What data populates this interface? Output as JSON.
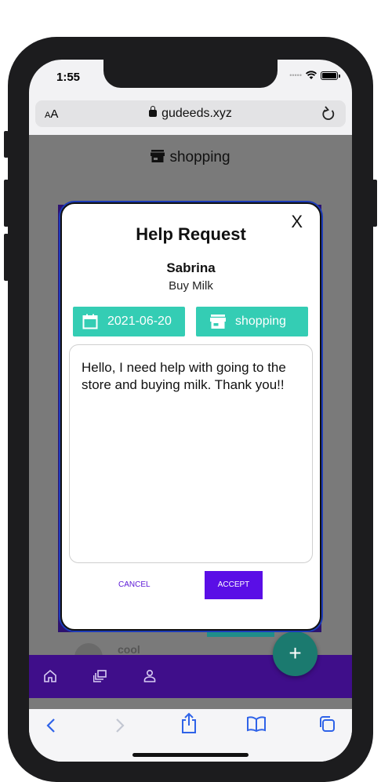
{
  "status": {
    "time": "1:55"
  },
  "browser": {
    "text_size_label": "AA",
    "url": "gudeeds.xyz"
  },
  "page": {
    "heading": "shopping",
    "background_item_name": "cool"
  },
  "modal": {
    "close": "X",
    "title": "Help Request",
    "requester": "Sabrina",
    "request_title": "Buy Milk",
    "date": "2021-06-20",
    "category": "shopping",
    "message": "Hello, I need help with going to the store and buying milk. Thank you!!",
    "cancel_label": "CANCEL",
    "accept_label": "ACCEPT"
  },
  "app_nav": {
    "icons": [
      "home-icon",
      "gallery-icon",
      "profile-icon"
    ],
    "fab_label": "+"
  },
  "toolbar": {
    "icons": [
      "back-icon",
      "forward-icon",
      "share-icon",
      "bookmarks-icon",
      "tabs-icon"
    ]
  },
  "colors": {
    "teal_chip": "#34cdb4",
    "accept": "#5a0ee6",
    "nav_purple": "#3f0e8a",
    "fab": "#1b7a6f",
    "overlay": "#7a7a7a"
  }
}
